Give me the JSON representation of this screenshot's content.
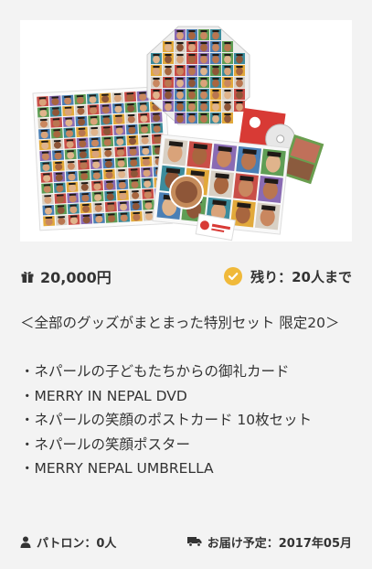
{
  "reward": {
    "price": "20,000円",
    "remaining": "残り：20人まで",
    "description_title": "＜全部のグッズがまとまった特別セット 限定20＞",
    "items": [
      "・ネパールの子どもたちからの御礼カード",
      "・MERRY IN NEPAL DVD",
      "・ネパールの笑顔のポストカード 10枚セット",
      "・ネパールの笑顔ポスター",
      "・MERRY NEPAL UMBRELLA"
    ],
    "patron": "パトロン：0人",
    "delivery": "お届け予定：2017年05月"
  },
  "colors": {
    "check_badge": "#f0b93a",
    "dvd_red": "#d83a35"
  },
  "icons": {
    "price": "gift-icon",
    "remaining": "check-circle-icon",
    "patron": "user-icon",
    "delivery": "truck-icon"
  }
}
